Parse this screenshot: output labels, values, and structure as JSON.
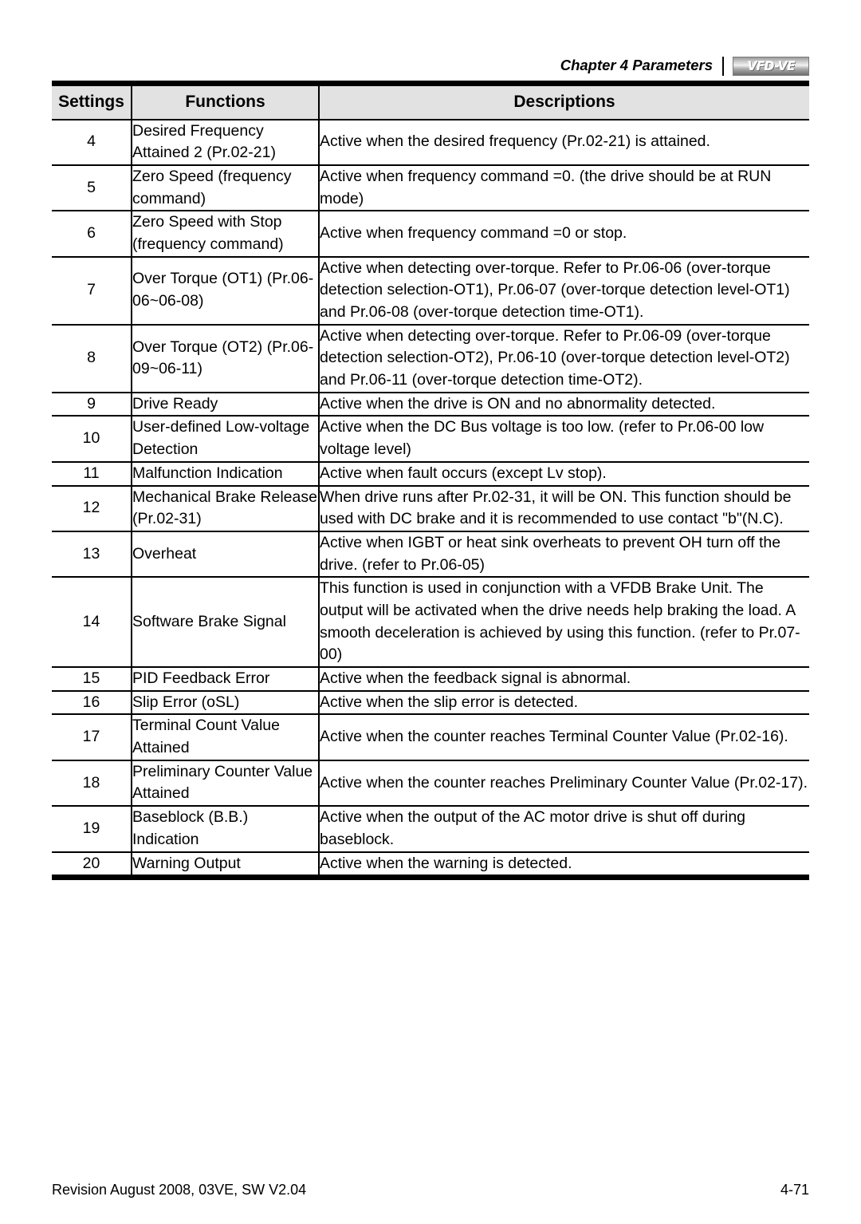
{
  "header": {
    "chapter_title": "Chapter 4 Parameters",
    "logo_text": "VFD-VE"
  },
  "table": {
    "columns": [
      "Settings",
      "Functions",
      "Descriptions"
    ],
    "rows": [
      {
        "setting": "4",
        "function": "Desired Frequency Attained 2 (Pr.02-21)",
        "description": "Active when the desired frequency (Pr.02-21) is attained."
      },
      {
        "setting": "5",
        "function": "Zero Speed (frequency command)",
        "description": "Active when frequency command =0. (the drive should be at RUN mode)"
      },
      {
        "setting": "6",
        "function": "Zero Speed with Stop (frequency command)",
        "description": "Active when frequency command =0 or stop."
      },
      {
        "setting": "7",
        "function": "Over Torque (OT1) (Pr.06-06~06-08)",
        "description": "Active when detecting over-torque. Refer to Pr.06-06 (over-torque detection selection-OT1), Pr.06-07 (over-torque detection level-OT1) and Pr.06-08 (over-torque detection time-OT1)."
      },
      {
        "setting": "8",
        "function": "Over Torque (OT2) (Pr.06-09~06-11)",
        "description": "Active when detecting over-torque. Refer to Pr.06-09 (over-torque detection selection-OT2), Pr.06-10 (over-torque detection level-OT2) and Pr.06-11 (over-torque detection time-OT2)."
      },
      {
        "setting": "9",
        "function": "Drive Ready",
        "description": "Active when the drive is ON and no abnormality detected."
      },
      {
        "setting": "10",
        "function": "User-defined Low-voltage Detection",
        "description": "Active when the DC Bus voltage is too low. (refer to Pr.06-00 low voltage level)"
      },
      {
        "setting": "11",
        "function": "Malfunction Indication",
        "description": "Active when fault occurs (except Lv stop)."
      },
      {
        "setting": "12",
        "function": "Mechanical Brake Release (Pr.02-31)",
        "description": "When drive runs after Pr.02-31, it will be ON. This function should be used with DC brake and it is recommended to use contact \"b\"(N.C)."
      },
      {
        "setting": "13",
        "function": "Overheat",
        "description": "Active when IGBT or heat sink overheats to prevent OH turn off the drive. (refer to Pr.06-05)"
      },
      {
        "setting": "14",
        "function": "Software Brake Signal",
        "description": "This function is used in conjunction with a VFDB Brake Unit. The output will be activated when the drive needs help braking the load. A smooth deceleration is achieved by using this function. (refer to Pr.07-00)"
      },
      {
        "setting": "15",
        "function": "PID Feedback Error",
        "description": "Active when the feedback signal is abnormal."
      },
      {
        "setting": "16",
        "function": "Slip Error (oSL)",
        "description": "Active when the slip error is detected."
      },
      {
        "setting": "17",
        "function": "Terminal Count Value Attained",
        "description": "Active when the counter reaches Terminal Counter Value (Pr.02-16)."
      },
      {
        "setting": "18",
        "function": "Preliminary Counter Value Attained",
        "description": "Active when the counter reaches Preliminary Counter Value (Pr.02-17)."
      },
      {
        "setting": "19",
        "function": "Baseblock (B.B.) Indication",
        "description": "Active when the output of the AC motor drive is shut off during baseblock."
      },
      {
        "setting": "20",
        "function": "Warning Output",
        "description": "Active when the warning is detected."
      }
    ]
  },
  "footer": {
    "revision": "Revision August 2008, 03VE, SW V2.04",
    "page_number": "4-71"
  }
}
